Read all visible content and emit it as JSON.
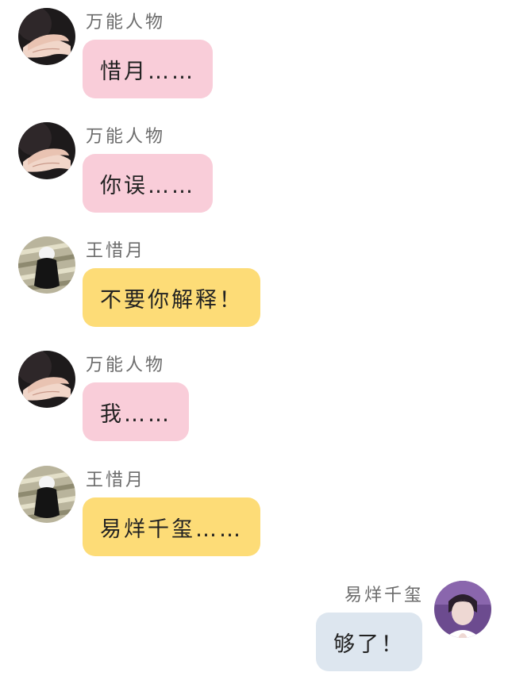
{
  "messages": [
    {
      "sender": "万能人物",
      "text": "惜月……",
      "bubble_color": "#f9cdd9",
      "avatar": "hands-avatar-icon"
    },
    {
      "sender": "万能人物",
      "text": "你误……",
      "bubble_color": "#f9cdd9",
      "avatar": "hands-avatar-icon"
    },
    {
      "sender": "王惜月",
      "text": "不要你解释！",
      "bubble_color": "#fddc77",
      "avatar": "girl-back-avatar-icon"
    },
    {
      "sender": "万能人物",
      "text": "我……",
      "bubble_color": "#f9cdd9",
      "avatar": "hands-avatar-icon"
    },
    {
      "sender": "王惜月",
      "text": "易烊千玺……",
      "bubble_color": "#fddc77",
      "avatar": "girl-back-avatar-icon"
    },
    {
      "sender": "易烊千玺",
      "text": "够了！",
      "bubble_color": "#dde6ef",
      "avatar": "boy-portrait-avatar-icon"
    }
  ]
}
